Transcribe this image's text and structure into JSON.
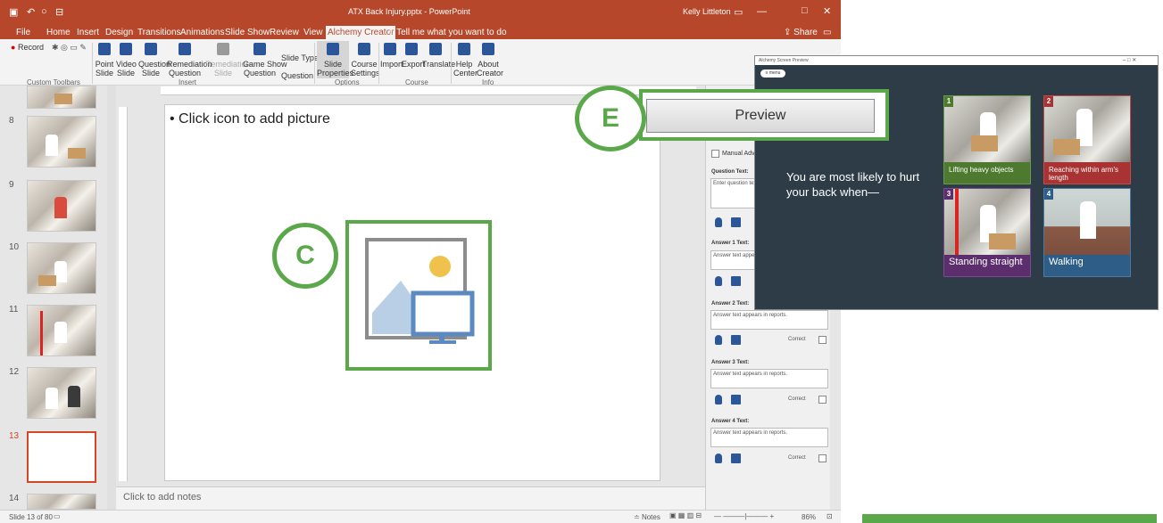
{
  "colors": {
    "ppt_accent": "#b7472a",
    "callout_green": "#5aa84a",
    "card1": "#4e7a2f",
    "card2": "#a93232",
    "card3": "#5d2e6e",
    "card4": "#2e5d87"
  },
  "window": {
    "title": "ATX Back Injury.pptx - PowerPoint",
    "user": "Kelly Littleton",
    "share": "Share"
  },
  "tabs": [
    "File",
    "Home",
    "Insert",
    "Design",
    "Transitions",
    "Animations",
    "Slide Show",
    "Review",
    "View",
    "Alchemy Creator"
  ],
  "tell_me": "Tell me what you want to do",
  "ribbon": {
    "record": "Record",
    "custom_toolbars": "Custom Toolbars",
    "insert": {
      "point_slide": [
        "Point",
        "Slide"
      ],
      "video_slide": [
        "Video",
        "Slide"
      ],
      "question_slide": [
        "Question",
        "Slide"
      ],
      "remediation_question": [
        "Remediation",
        "Question"
      ],
      "remediation_slide": [
        "Remediation",
        "Slide"
      ],
      "game_show_question": [
        "Game Show",
        "Question"
      ],
      "group": "Insert"
    },
    "slide_type": {
      "label": "Slide Type:",
      "value": "Question"
    },
    "options": {
      "slide_properties": [
        "Slide",
        "Properties"
      ],
      "course_settings": [
        "Course",
        "Settings"
      ],
      "group": "Options"
    },
    "course": {
      "import": "Import",
      "export": "Export",
      "translate": "Translate",
      "group": "Course"
    },
    "info": {
      "help_center": [
        "Help",
        "Center"
      ],
      "about_creator": [
        "About",
        "Creator"
      ],
      "group": "Info"
    }
  },
  "thumbnails": {
    "numbers": [
      "8",
      "9",
      "10",
      "11",
      "12",
      "13",
      "14"
    ]
  },
  "slide": {
    "bullet": "• Click icon to add picture"
  },
  "notes_placeholder": "Click to add notes",
  "status": {
    "slide_count": "Slide 13 of 80",
    "notes": "Notes",
    "zoom": "86%"
  },
  "pane": {
    "manual_advance": "Manual Advanc",
    "question_label": "Question Text:",
    "question_box": "Enter question text. will appear in report",
    "answer1_label": "Answer 1 Text:",
    "answer1_box": "Answer text appears",
    "answer2_label": "Answer 2 Text:",
    "answer2_box": "Answer text appears in reports.",
    "answer3_label": "Answer 3 Text:",
    "answer3_box": "Answer text appears in reports.",
    "answer4_label": "Answer 4 Text:",
    "answer4_box": "Answer text appears in reports.",
    "correct": "Correct"
  },
  "callouts": {
    "c": "C",
    "e": "E"
  },
  "preview_button": "Preview",
  "preview_window": {
    "title": "Alchemy Screen Preview",
    "menu": "menu",
    "question": "You are most likely to hurt your back when—",
    "cards": [
      {
        "num": "1",
        "label": "Lifting heavy objects"
      },
      {
        "num": "2",
        "label": "Reaching within arm's length"
      },
      {
        "num": "3",
        "label": "Standing straight"
      },
      {
        "num": "4",
        "label": "Walking"
      }
    ]
  }
}
